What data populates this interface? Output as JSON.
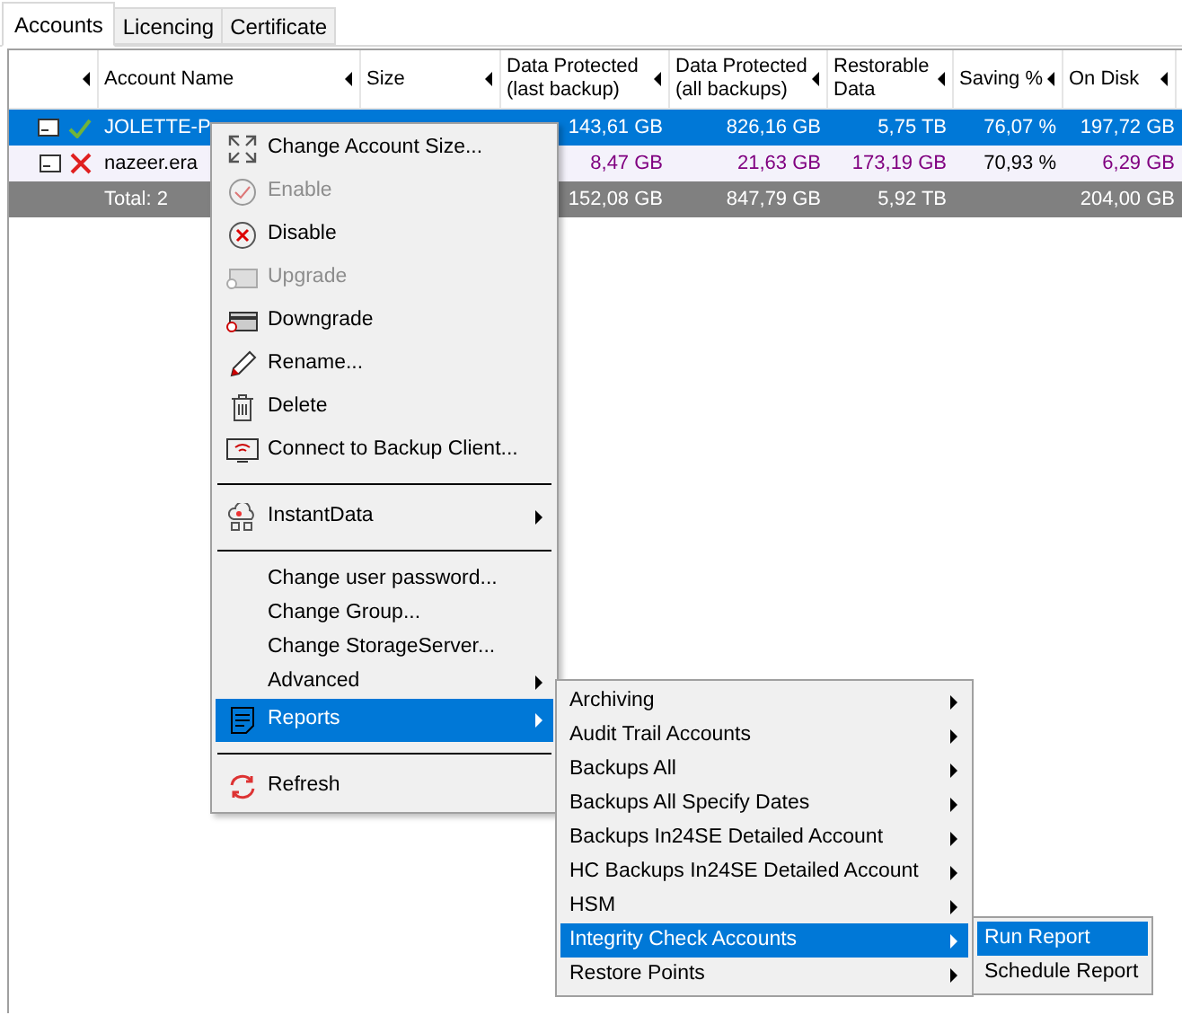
{
  "tabs": [
    {
      "label": "Accounts",
      "selected": true
    },
    {
      "label": "Licencing",
      "selected": false
    },
    {
      "label": "Certificate",
      "selected": false
    }
  ],
  "table": {
    "columns": [
      {},
      {
        "label": "Account Name"
      },
      {
        "label": "Size"
      },
      {
        "label": "Data Protected\n(last backup)"
      },
      {
        "label": "Data Protected\n(all backups)"
      },
      {
        "label": "Restorable\nData"
      },
      {
        "label": "Saving %"
      },
      {
        "label": "On Disk"
      }
    ],
    "rows": [
      {
        "kind": "account",
        "selected": true,
        "enabled": true,
        "name": "JOLETTE-P",
        "data_last": {
          "text": "143,61 GB",
          "color": "#ffffff"
        },
        "data_all": {
          "text": "826,16 GB",
          "color": "#ffffff"
        },
        "restorable": {
          "text": "5,75 TB",
          "color": "#ffffff"
        },
        "saving": {
          "text": "76,07 %",
          "color": "#ffffff"
        },
        "on_disk": {
          "text": "197,72 GB",
          "color": "#ffffff"
        }
      },
      {
        "kind": "account",
        "selected": false,
        "enabled": false,
        "name": "nazeer.era",
        "data_last": {
          "text": "8,47 GB",
          "color": "#800080"
        },
        "data_all": {
          "text": "21,63 GB",
          "color": "#800080"
        },
        "restorable": {
          "text": "173,19 GB",
          "color": "#800080"
        },
        "saving": {
          "text": "70,93 %",
          "color": "#000000"
        },
        "on_disk": {
          "text": "6,29 GB",
          "color": "#800080"
        }
      },
      {
        "kind": "total",
        "name": "Total: 2",
        "data_last": {
          "text": "152,08 GB",
          "color": "#ffffff"
        },
        "data_all": {
          "text": "847,79 GB",
          "color": "#ffffff"
        },
        "restorable": {
          "text": "5,92 TB",
          "color": "#ffffff"
        },
        "on_disk": {
          "text": "204,00 GB",
          "color": "#ffffff"
        }
      }
    ]
  },
  "context_menu": {
    "items": [
      {
        "kind": "item",
        "label": "Change Account Size...",
        "disabled": false,
        "submenu": false,
        "selected": false
      },
      {
        "kind": "item",
        "label": "Enable",
        "disabled": true,
        "submenu": false,
        "selected": false
      },
      {
        "kind": "item",
        "label": "Disable",
        "disabled": false,
        "submenu": false,
        "selected": false
      },
      {
        "kind": "item",
        "label": "Upgrade",
        "disabled": true,
        "submenu": false,
        "selected": false
      },
      {
        "kind": "item",
        "label": "Downgrade",
        "disabled": false,
        "submenu": false,
        "selected": false
      },
      {
        "kind": "item",
        "label": "Rename...",
        "disabled": false,
        "submenu": false,
        "selected": false
      },
      {
        "kind": "item",
        "label": "Delete",
        "disabled": false,
        "submenu": false,
        "selected": false
      },
      {
        "kind": "item",
        "label": "Connect to Backup Client...",
        "disabled": false,
        "submenu": false,
        "selected": false
      },
      {
        "kind": "separator"
      },
      {
        "kind": "item",
        "label": "InstantData",
        "disabled": false,
        "submenu": true,
        "selected": false
      },
      {
        "kind": "separator"
      },
      {
        "kind": "text",
        "label": "Change user password...",
        "disabled": false,
        "submenu": false,
        "selected": false
      },
      {
        "kind": "text",
        "label": "Change Group...",
        "disabled": false,
        "submenu": false,
        "selected": false
      },
      {
        "kind": "text",
        "label": "Change StorageServer...",
        "disabled": false,
        "submenu": false,
        "selected": false
      },
      {
        "kind": "text",
        "label": "Advanced",
        "disabled": false,
        "submenu": true,
        "selected": false
      },
      {
        "kind": "item",
        "label": "Reports",
        "disabled": false,
        "submenu": true,
        "selected": true
      },
      {
        "kind": "separator"
      },
      {
        "kind": "item",
        "label": "Refresh",
        "disabled": false,
        "submenu": false,
        "selected": false
      }
    ]
  },
  "reports_menu": {
    "items": [
      {
        "label": "Archiving",
        "submenu": true,
        "selected": false
      },
      {
        "label": "Audit Trail Accounts",
        "submenu": true,
        "selected": false
      },
      {
        "label": "Backups All",
        "submenu": true,
        "selected": false
      },
      {
        "label": "Backups All Specify Dates",
        "submenu": true,
        "selected": false
      },
      {
        "label": "Backups In24SE Detailed Account",
        "submenu": true,
        "selected": false
      },
      {
        "label": "HC Backups In24SE Detailed Account",
        "submenu": true,
        "selected": false
      },
      {
        "label": "HSM",
        "submenu": true,
        "selected": false
      },
      {
        "label": "Integrity Check Accounts",
        "submenu": true,
        "selected": true
      },
      {
        "label": "Restore Points",
        "submenu": true,
        "selected": false
      }
    ]
  },
  "integrity_menu": {
    "items": [
      {
        "label": "Run Report",
        "selected": true
      },
      {
        "label": "Schedule Report",
        "selected": false
      }
    ]
  }
}
